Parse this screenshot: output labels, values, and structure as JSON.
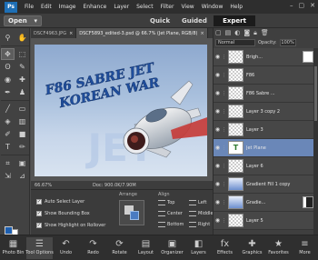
{
  "app": {
    "logo_text": "Ps",
    "menu": [
      "File",
      "Edit",
      "Image",
      "Enhance",
      "Layer",
      "Select",
      "Filter",
      "View",
      "Window",
      "Help"
    ],
    "window_controls": [
      "–",
      "▢",
      "✕"
    ]
  },
  "modebar": {
    "open_label": "Open",
    "modes": [
      "Quick",
      "Guided",
      "Expert"
    ],
    "active_mode": "Expert"
  },
  "doc_tabs": [
    {
      "label": "DSCF4963.JPG"
    },
    {
      "label": "DSCF5893_edited-3.psd @ 66.7% (Jet Plane, RGB/8)"
    }
  ],
  "canvas": {
    "headline_line1": "F86 SABRE JET",
    "headline_line2": "KOREAN WAR",
    "headline_color": "#1f4e9e",
    "watermark": "JET"
  },
  "status": {
    "zoom": "66.67%",
    "doc": "Doc: 900.0K/7.90M"
  },
  "layers_panel": {
    "blend_mode": "Normal",
    "opacity_label": "Opacity:",
    "opacity_value": "100%",
    "tool_icons": [
      "new-layer-icon",
      "group-icon",
      "adjustment-icon",
      "mask-icon",
      "lock-icon",
      "trash-icon"
    ],
    "layers": [
      {
        "name": "Brigh...",
        "thumb": "checker",
        "mask": "plain",
        "selected": false
      },
      {
        "name": "F86",
        "thumb": "checker",
        "mask": "",
        "selected": false
      },
      {
        "name": "F86 Sabre ...",
        "thumb": "checker",
        "mask": "",
        "selected": false
      },
      {
        "name": "Layer 3 copy 2",
        "thumb": "checker",
        "mask": "",
        "selected": false
      },
      {
        "name": "Layer 3",
        "thumb": "checker",
        "mask": "",
        "selected": false
      },
      {
        "name": "Jet Plane",
        "thumb": "text",
        "mask": "",
        "selected": true
      },
      {
        "name": "Layer 6",
        "thumb": "checker",
        "mask": "",
        "selected": false
      },
      {
        "name": "Gradient Fill 1 copy",
        "thumb": "grad",
        "mask": "",
        "selected": false
      },
      {
        "name": "Gradie...",
        "thumb": "grad",
        "mask": "dark",
        "selected": false
      },
      {
        "name": "Layer 5",
        "thumb": "checker",
        "mask": "",
        "selected": false
      }
    ]
  },
  "tool_options": {
    "auto_select": "Auto Select Layer",
    "show_bbox": "Show Bounding Box",
    "show_highlight": "Show Highlight on Rollover",
    "arrange_title": "Arrange",
    "align_title": "Align",
    "align_items": [
      "Top",
      "Left",
      "Center",
      "Middle",
      "Bottom",
      "Right"
    ]
  },
  "dock": [
    {
      "label": "Photo Bin",
      "icon": "photo-bin-icon",
      "glyph": "▦"
    },
    {
      "label": "Tool Options",
      "icon": "tool-options-icon",
      "glyph": "☰"
    },
    {
      "label": "Undo",
      "icon": "undo-icon",
      "glyph": "↶"
    },
    {
      "label": "Redo",
      "icon": "redo-icon",
      "glyph": "↷"
    },
    {
      "label": "Rotate",
      "icon": "rotate-icon",
      "glyph": "⟳"
    },
    {
      "label": "Layout",
      "icon": "layout-icon",
      "glyph": "▤"
    },
    {
      "label": "Organizer",
      "icon": "organizer-icon",
      "glyph": "▣"
    },
    {
      "label": "Layers",
      "icon": "layers-icon",
      "glyph": "◧"
    },
    {
      "label": "Effects",
      "icon": "effects-icon",
      "glyph": "fx"
    },
    {
      "label": "Graphics",
      "icon": "graphics-icon",
      "glyph": "✚"
    },
    {
      "label": "Favorites",
      "icon": "favorites-icon",
      "glyph": "★"
    },
    {
      "label": "More",
      "icon": "more-icon",
      "glyph": "≡"
    }
  ]
}
